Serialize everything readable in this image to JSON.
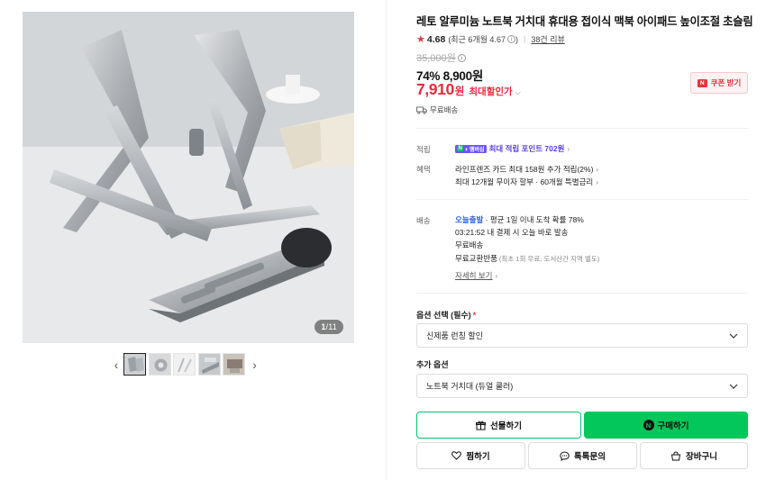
{
  "gallery": {
    "counter_current": "1",
    "counter_total": "/11",
    "thumbnail_count": 5,
    "active_thumbnail": 1
  },
  "product": {
    "title": "레토 알루미늄 노트북 거치대 휴대용 접이식 맥북 아이패드 높이조절 초슬림",
    "rating": "4.68",
    "rating_sub": "(최근 6개월 4.67",
    "rating_sub_close": ")",
    "review_link": "38건 리뷰"
  },
  "price": {
    "original": "35,000원",
    "sale_line": "74% 8,900원",
    "max_price": "7,910",
    "max_won": "원",
    "max_label": "최대할인가",
    "coupon_label": "쿠폰 받기",
    "coupon_badge": "N",
    "free_shipping": "무료배송"
  },
  "benefits": {
    "points_label": "적립",
    "npay_n": "N",
    "npay_badge": "+ 멤버십",
    "points_text": "최대 적립 포인트 702원",
    "benefit_label": "혜택",
    "benefit_line1": "라인프렌즈 카드 최대 158원 추가 적립(2%)",
    "benefit_line2": "최대 12개월 무이자 할부 · 60개월 특별금리"
  },
  "delivery": {
    "label": "배송",
    "today_tag": "오늘출발",
    "today_text": " · 평균 1일 이내 도착 확률 78%",
    "cutoff": "03:21:52 내 결제 시 오늘 바로 발송",
    "free": "무료배송",
    "exchange": "무료교환반품",
    "exchange_note": "(최초 1회 무료, 도서산간 지역 별도)",
    "detail_link": "자세히 보기"
  },
  "options": {
    "required_label": "옵션 선택 (필수)",
    "required_mark": "*",
    "required_value": "신제품 런칭 할인",
    "extra_label": "추가 옵션",
    "extra_value": "노트북 거치대 (듀얼 쿨러)"
  },
  "actions": {
    "gift": "선물하기",
    "buy": "구매하기",
    "buy_badge": "N",
    "wish": "찜하기",
    "talk": "톡톡문의",
    "cart": "장바구니"
  },
  "colors": {
    "accent_red": "#e8353b",
    "naver_green": "#03c75a",
    "link_blue": "#2b62e6",
    "point_purple": "#5a3fe0"
  },
  "icons": {
    "star": "star-icon",
    "info": "info-icon",
    "truck": "truck-icon",
    "gift": "gift-icon",
    "heart": "heart-icon",
    "chat": "chat-bubble-icon",
    "cart": "cart-icon",
    "caret": "chevron-down-icon"
  }
}
